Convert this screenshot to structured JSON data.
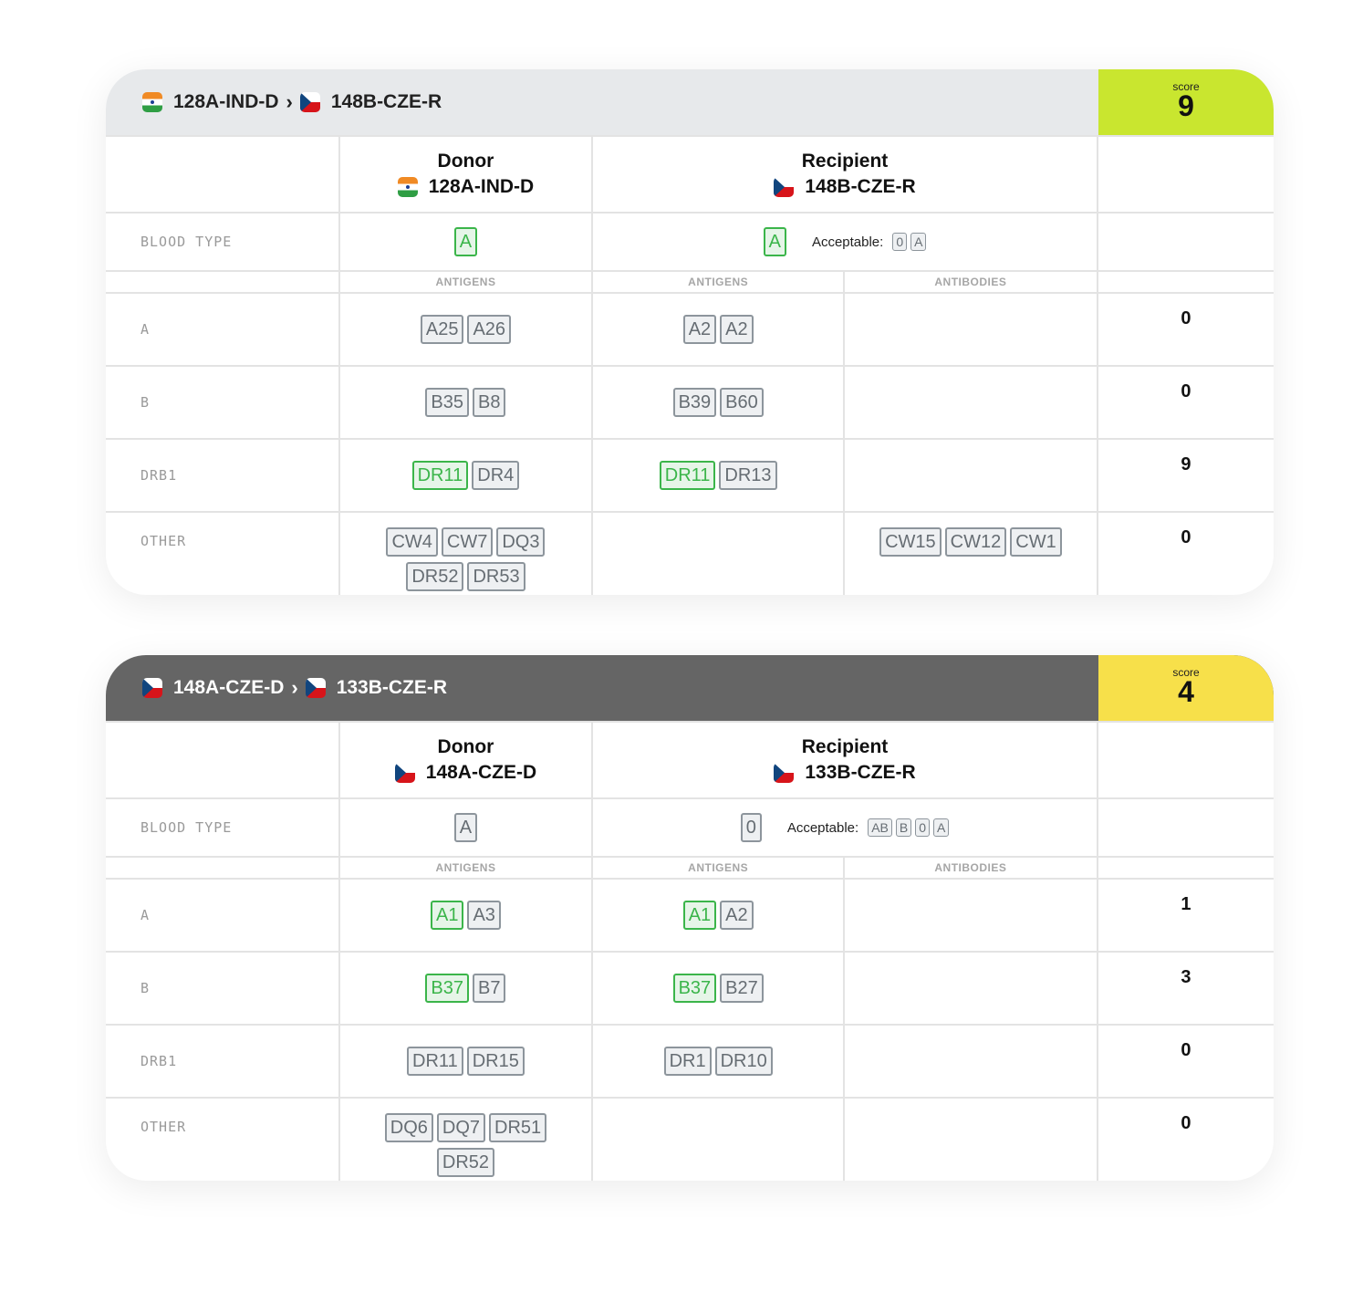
{
  "score_label": "score",
  "blood_type_label": "BLOOD TYPE",
  "donor_label": "Donor",
  "recipient_label": "Recipient",
  "acceptable_label": "Acceptable:",
  "antigens_label": "ANTIGENS",
  "antibodies_label": "ANTIBODIES",
  "row_labels": {
    "a": "A",
    "b": "B",
    "drb1": "DRB1",
    "other": "OTHER"
  },
  "colors": {
    "match_green": "#3bb54a",
    "score_high": "#c9e62f",
    "score_mid": "#f7e04a"
  },
  "transplants": [
    {
      "donor_id": "128A-IND-D",
      "donor_flag": "india-flag-icon",
      "recipient_id": "148B-CZE-R",
      "recipient_flag": "czech-flag-icon",
      "score": "9",
      "donor_blood": "A",
      "recipient_blood": "A",
      "acceptable": [
        "0",
        "A"
      ],
      "a": {
        "donor": [
          "A25",
          "A26"
        ],
        "recipient": [
          "A2",
          "A2"
        ],
        "antibodies": [],
        "score": "0"
      },
      "b": {
        "donor": [
          "B35",
          "B8"
        ],
        "recipient": [
          "B39",
          "B60"
        ],
        "antibodies": [],
        "score": "0"
      },
      "drb1": {
        "donor": [
          "DR11",
          "DR4"
        ],
        "recipient": [
          "DR11",
          "DR13"
        ],
        "antibodies": [],
        "score": "9"
      },
      "other": {
        "donor": [
          "CW4",
          "CW7",
          "DQ3",
          "DR52",
          "DR53"
        ],
        "recipient": [],
        "antibodies": [
          "CW15",
          "CW12",
          "CW1"
        ],
        "score": "0"
      }
    },
    {
      "donor_id": "148A-CZE-D",
      "donor_flag": "czech-flag-icon",
      "recipient_id": "133B-CZE-R",
      "recipient_flag": "czech-flag-icon",
      "score": "4",
      "donor_blood": "A",
      "recipient_blood": "0",
      "acceptable": [
        "AB",
        "B",
        "0",
        "A"
      ],
      "a": {
        "donor": [
          "A1",
          "A3"
        ],
        "recipient": [
          "A1",
          "A2"
        ],
        "antibodies": [],
        "score": "1"
      },
      "b": {
        "donor": [
          "B37",
          "B7"
        ],
        "recipient": [
          "B37",
          "B27"
        ],
        "antibodies": [],
        "score": "3"
      },
      "drb1": {
        "donor": [
          "DR11",
          "DR15"
        ],
        "recipient": [
          "DR1",
          "DR10"
        ],
        "antibodies": [],
        "score": "0"
      },
      "other": {
        "donor": [
          "DQ6",
          "DQ7",
          "DR51",
          "DR52"
        ],
        "recipient": [],
        "antibodies": [],
        "score": "0"
      }
    }
  ]
}
